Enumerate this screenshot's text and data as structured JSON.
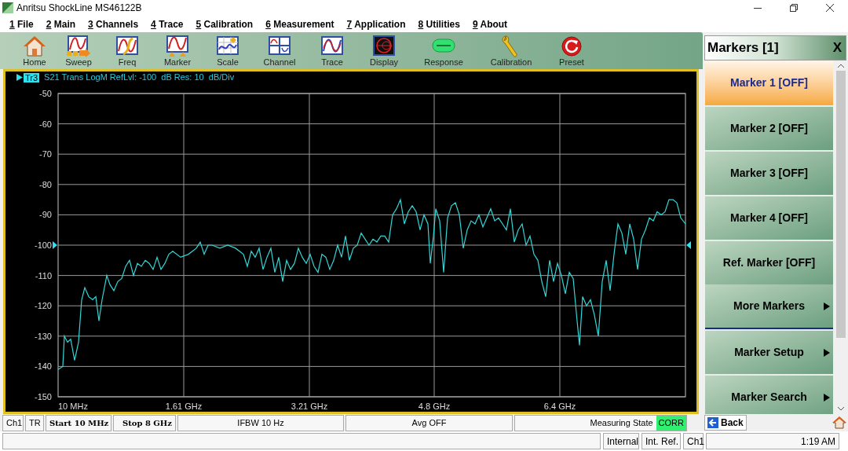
{
  "window": {
    "title": "Anritsu ShockLine MS46122B"
  },
  "menu": [
    {
      "key": "1",
      "label": "File"
    },
    {
      "key": "2",
      "label": "Main"
    },
    {
      "key": "3",
      "label": "Channels"
    },
    {
      "key": "4",
      "label": "Trace"
    },
    {
      "key": "5",
      "label": "Calibration"
    },
    {
      "key": "6",
      "label": "Measurement"
    },
    {
      "key": "7",
      "label": "Application"
    },
    {
      "key": "8",
      "label": "Utilities"
    },
    {
      "key": "9",
      "label": "About"
    }
  ],
  "toolbar": [
    {
      "label": "Home"
    },
    {
      "label": "Sweep"
    },
    {
      "label": "Freq"
    },
    {
      "label": "Marker"
    },
    {
      "label": "Scale"
    },
    {
      "label": "Channel"
    },
    {
      "label": "Trace"
    },
    {
      "label": "Display"
    },
    {
      "label": "Response"
    },
    {
      "label": "Calibration"
    },
    {
      "label": "Preset"
    }
  ],
  "trace_header": {
    "trace": "Tr3",
    "text": "S21 Trans LogM RefLvl: -100  dB Res: 10  dB/Div"
  },
  "plot": {
    "start_label": "10 MHz",
    "chart_data": {
      "type": "line",
      "xlim": [
        0.01,
        8
      ],
      "ylim": [
        -150,
        -50
      ],
      "grid": true,
      "xticks": [
        {
          "value": 1.61,
          "label": "1.61 GHz"
        },
        {
          "value": 3.21,
          "label": "3.21 GHz"
        },
        {
          "value": 4.8,
          "label": "4.8 GHz"
        },
        {
          "value": 6.4,
          "label": "6.4 GHz"
        }
      ],
      "yticks": [
        -50,
        -60,
        -70,
        -80,
        -90,
        -100,
        -110,
        -120,
        -130,
        -140,
        -150
      ],
      "x": [
        0.01,
        0.07,
        0.09,
        0.13,
        0.17,
        0.22,
        0.27,
        0.31,
        0.35,
        0.4,
        0.45,
        0.49,
        0.53,
        0.57,
        0.63,
        0.67,
        0.72,
        0.77,
        0.82,
        0.87,
        0.92,
        0.97,
        1.02,
        1.07,
        1.12,
        1.17,
        1.22,
        1.27,
        1.32,
        1.37,
        1.42,
        1.47,
        1.57,
        1.67,
        1.77,
        1.82,
        1.87,
        1.92,
        1.97,
        2.07,
        2.17,
        2.27,
        2.37,
        2.42,
        2.47,
        2.52,
        2.57,
        2.62,
        2.67,
        2.72,
        2.77,
        2.82,
        2.87,
        2.92,
        2.97,
        3.02,
        3.07,
        3.12,
        3.17,
        3.22,
        3.27,
        3.32,
        3.37,
        3.42,
        3.47,
        3.52,
        3.57,
        3.62,
        3.67,
        3.72,
        3.77,
        3.82,
        3.87,
        3.92,
        3.97,
        4.02,
        4.07,
        4.12,
        4.17,
        4.22,
        4.27,
        4.32,
        4.37,
        4.42,
        4.47,
        4.52,
        4.57,
        4.62,
        4.67,
        4.72,
        4.75,
        4.79,
        4.82,
        4.87,
        4.92,
        4.97,
        5.02,
        5.07,
        5.12,
        5.17,
        5.22,
        5.27,
        5.32,
        5.37,
        5.42,
        5.47,
        5.52,
        5.57,
        5.62,
        5.67,
        5.72,
        5.77,
        5.82,
        5.87,
        5.92,
        5.97,
        6.02,
        6.07,
        6.12,
        6.17,
        6.22,
        6.27,
        6.32,
        6.37,
        6.42,
        6.47,
        6.52,
        6.57,
        6.62,
        6.65,
        6.69,
        6.74,
        6.79,
        6.84,
        6.89,
        6.94,
        6.99,
        7.04,
        7.09,
        7.14,
        7.19,
        7.24,
        7.29,
        7.34,
        7.39,
        7.44,
        7.49,
        7.54,
        7.59,
        7.64,
        7.69,
        7.74,
        7.79,
        7.84,
        7.89,
        7.94,
        8.0
      ],
      "series": [
        {
          "color": "#33d6d6",
          "values": [
            -141,
            -140,
            -130,
            -132,
            -131,
            -138,
            -132,
            -118,
            -114,
            -117,
            -118,
            -117,
            -125,
            -118,
            -110,
            -113,
            -115,
            -112,
            -111,
            -107,
            -105,
            -110,
            -106,
            -107,
            -105,
            -106,
            -108,
            -104,
            -108,
            -106,
            -103,
            -102,
            -104,
            -103,
            -101,
            -99,
            -103,
            -100,
            -100,
            -101,
            -100,
            -101,
            -103,
            -107,
            -102,
            -104,
            -101,
            -108,
            -104,
            -101,
            -109,
            -104,
            -112,
            -105,
            -108,
            -106,
            -101,
            -104,
            -106,
            -103,
            -107,
            -109,
            -103,
            -104,
            -108,
            -105,
            -100,
            -104,
            -97,
            -105,
            -101,
            -100,
            -96,
            -98,
            -100,
            -98,
            -99,
            -97,
            -97,
            -99,
            -90,
            -88,
            -85,
            -93,
            -89,
            -87,
            -89,
            -95,
            -90,
            -93,
            -106,
            -97,
            -88,
            -92,
            -109,
            -91,
            -87,
            -86,
            -90,
            -101,
            -95,
            -92,
            -93,
            -90,
            -94,
            -91,
            -88,
            -92,
            -91,
            -93,
            -95,
            -88,
            -99,
            -95,
            -93,
            -100,
            -97,
            -103,
            -105,
            -112,
            -117,
            -105,
            -112,
            -106,
            -110,
            -116,
            -109,
            -111,
            -125,
            -133,
            -117,
            -120,
            -118,
            -123,
            -130,
            -112,
            -105,
            -115,
            -103,
            -93,
            -96,
            -103,
            -93,
            -98,
            -108,
            -98,
            -95,
            -91,
            -92,
            -89,
            -90,
            -89,
            -85,
            -85,
            -86,
            -91,
            -93
          ]
        }
      ]
    }
  },
  "markers_panel": {
    "title": "Markers [1]",
    "close": "X",
    "items": [
      {
        "label": "Marker 1 [OFF]",
        "selected": true,
        "submenu": false,
        "divider_after": false
      },
      {
        "label": "Marker 2 [OFF]",
        "selected": false,
        "submenu": false,
        "divider_after": false
      },
      {
        "label": "Marker 3 [OFF]",
        "selected": false,
        "submenu": false,
        "divider_after": false
      },
      {
        "label": "Marker 4 [OFF]",
        "selected": false,
        "submenu": false,
        "divider_after": false
      },
      {
        "label": "Ref. Marker [OFF]",
        "selected": false,
        "submenu": false,
        "divider_after": false
      },
      {
        "label": "More Markers",
        "selected": false,
        "submenu": true,
        "divider_after": true
      },
      {
        "label": "Marker Setup",
        "selected": false,
        "submenu": true,
        "divider_after": false
      },
      {
        "label": "Marker Search",
        "selected": false,
        "submenu": true,
        "divider_after": false
      }
    ]
  },
  "status_bar": {
    "channel": "Ch1",
    "trace": "TR",
    "start": "Start 10 MHz",
    "stop": "Stop 8 GHz",
    "ifbw": "IFBW 10 Hz",
    "averaging": "Avg OFF",
    "state_label": "Measuring State",
    "state": "CORR",
    "back_button": "Back"
  },
  "footer": {
    "sweep_source": "Internal",
    "reference": "Int. Ref.",
    "channel": "Ch1",
    "time": "1:19 AM"
  }
}
